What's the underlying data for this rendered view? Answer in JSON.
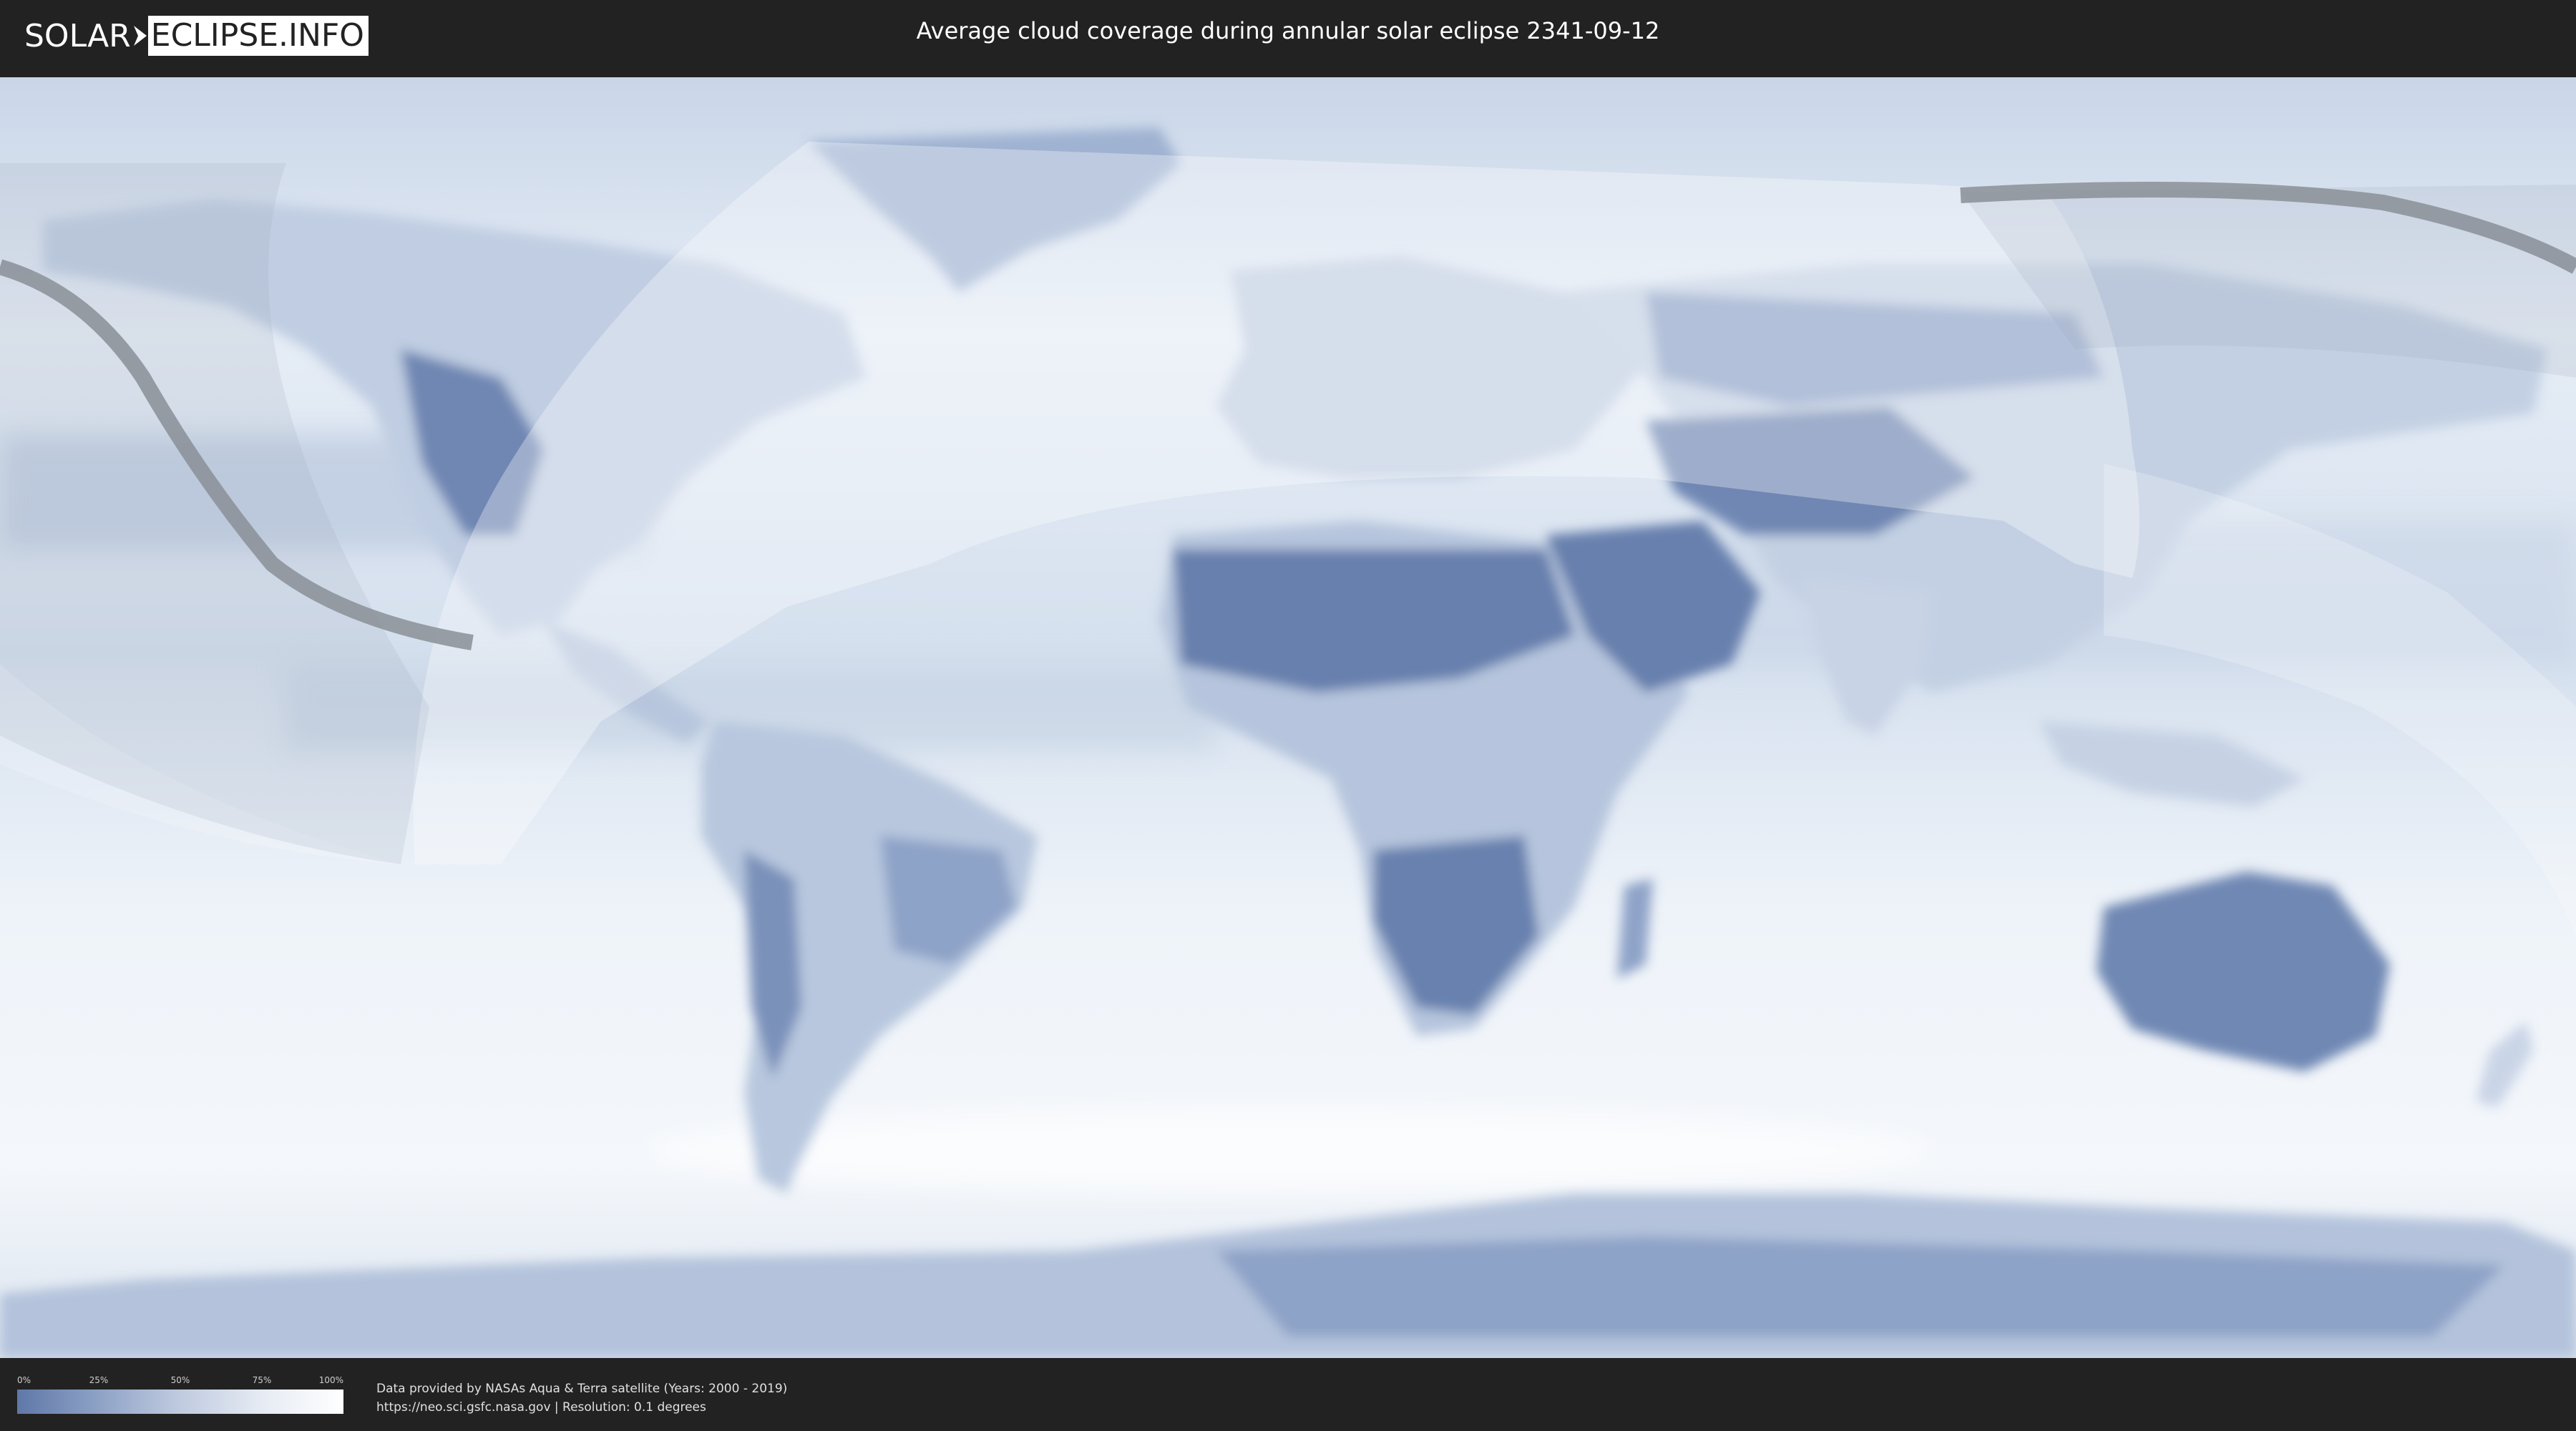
{
  "header": {
    "logo_left": "SOLAR",
    "logo_right": "ECLIPSE.INFO",
    "title": "Average cloud coverage during annular solar eclipse 2341-09-12"
  },
  "legend": {
    "ticks": [
      "0%",
      "25%",
      "50%",
      "75%",
      "100%"
    ],
    "tick_fractions": [
      0,
      0.25,
      0.5,
      0.75,
      1.0
    ],
    "colors": {
      "low": "#5f78a8",
      "high": "#ffffff"
    }
  },
  "footer": {
    "credit_line": "Data provided by NASAs Aqua & Terra satellite (Years: 2000 - 2019)",
    "source_line": "https://neo.sci.gsfc.nasa.gov | Resolution: 0.1 degrees"
  },
  "map": {
    "projection": "equirectangular",
    "layers": [
      "cloud-coverage",
      "country-borders",
      "eclipse-visibility-zone",
      "annularity-path"
    ],
    "colors": {
      "clear_land": "#6d85b1",
      "cloudy": "#f3f6fb",
      "path": "#8a8f96",
      "overlay": "#ffffff"
    }
  }
}
